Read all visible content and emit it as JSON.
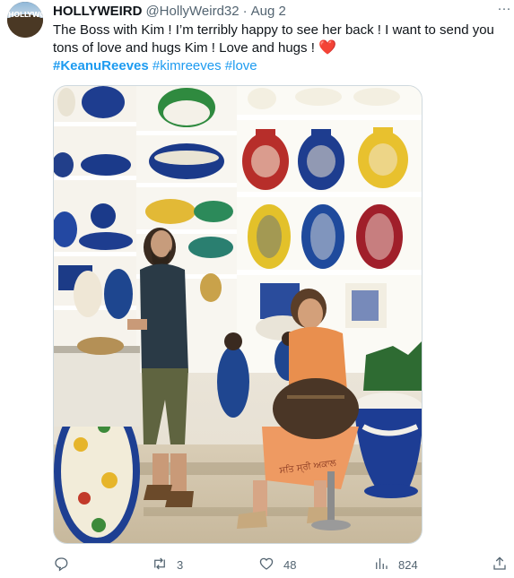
{
  "tweet": {
    "avatar_text": "HOLLYWO",
    "display_name": "HOLLYWEIRD",
    "handle": "@HollyWeird32",
    "separator": "·",
    "date": "Aug 2",
    "more_label": "···",
    "body": "The Boss with Kim ! I’m terribly happy to see her back ! I want to send you tons of love and hugs Kim ! Love and hugs !",
    "heart_emoji": "❤️",
    "hashtags": [
      "#KeanuReeves",
      "#kimreeves",
      "#love"
    ],
    "photo_texts": {
      "dress_text": "ਸਤਿ ਸ੍ਰੀ ਅਕਾਲ"
    }
  },
  "stats": {
    "replies": "",
    "retweets": "3",
    "likes": "48",
    "views": "824"
  },
  "icons": {
    "reply": "reply-icon",
    "retweet": "retweet-icon",
    "like": "heart-icon",
    "views": "views-icon",
    "share": "share-icon"
  },
  "colors": {
    "link": "#1d9bf0",
    "secondary": "#536471",
    "text": "#0f1419",
    "heart": "#e0245e"
  }
}
